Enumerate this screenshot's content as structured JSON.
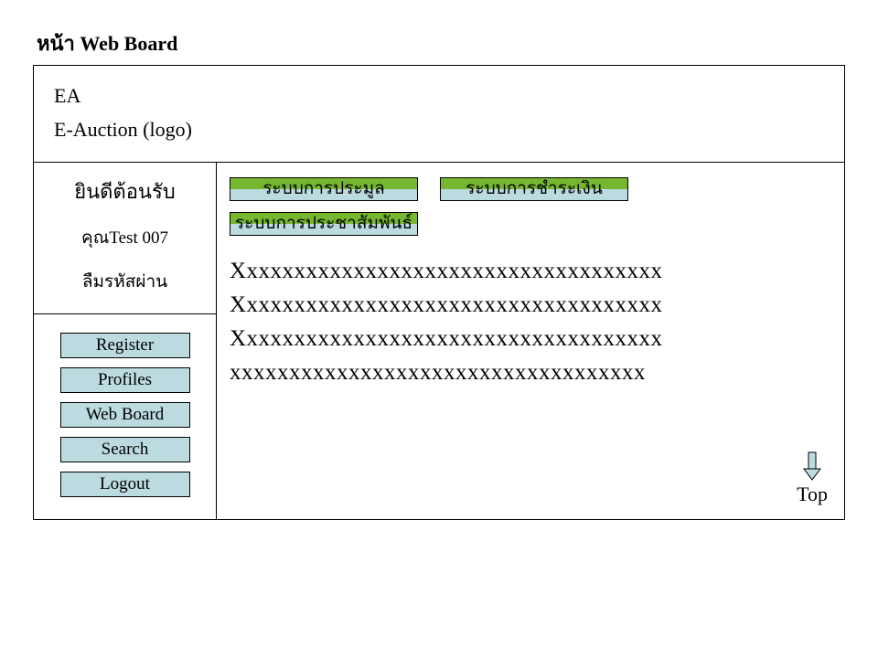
{
  "page_title": "หน้า Web Board",
  "header": {
    "logo_short": "EA",
    "logo_long": "E-Auction (logo)"
  },
  "sidebar": {
    "welcome": "ยินดีต้อนรับ",
    "user": "คุณTest 007",
    "forgot": "ลืมรหัสผ่าน",
    "nav": {
      "register": "Register",
      "profiles": "Profiles",
      "webboard": "Web Board",
      "search": "Search",
      "logout": "Logout"
    }
  },
  "main": {
    "bars": {
      "auction": "ระบบการประมูล",
      "payment": "ระบบการชำระเงิน",
      "pr": "ระบบการประชาสัมพันธ์"
    },
    "lines": {
      "l1": "Xxxxxxxxxxxxxxxxxxxxxxxxxxxxxxxxxxxx",
      "l2": "Xxxxxxxxxxxxxxxxxxxxxxxxxxxxxxxxxxxx",
      "l3": "Xxxxxxxxxxxxxxxxxxxxxxxxxxxxxxxxxxxx",
      "l4": "xxxxxxxxxxxxxxxxxxxxxxxxxxxxxxxxxxx"
    },
    "top_label": "Top"
  },
  "colors": {
    "button_bg": "#bbdbe0",
    "bar_top": "#76b72f",
    "bar_bottom": "#bbdbe0"
  }
}
